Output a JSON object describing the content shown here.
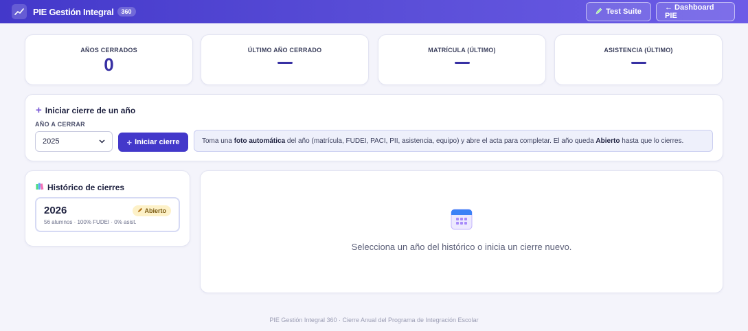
{
  "header": {
    "title": "PIE Gestión Integral",
    "badge": "360",
    "test_suite_label": "Test Suite",
    "dashboard_label": "← Dashboard PIE"
  },
  "stats": [
    {
      "label": "AÑOS CERRADOS",
      "value": "0"
    },
    {
      "label": "ÚLTIMO AÑO CERRADO",
      "value": "—"
    },
    {
      "label": "MATRÍCULA (ÚLTIMO)",
      "value": "—"
    },
    {
      "label": "ASISTENCIA (ÚLTIMO)",
      "value": "—"
    }
  ],
  "start_section": {
    "title": "Iniciar cierre de un año",
    "field_label": "AÑO A CERRAR",
    "selected_year": "2025",
    "button_label": "Iniciar cierre",
    "info": {
      "part1": "Toma una ",
      "bold1": "foto automática",
      "part2": " del año (matrícula, FUDEI, PACI, PII, asistencia, equipo) y abre el acta para completar. El año queda ",
      "bold2": "Abierto",
      "part3": " hasta que lo cierres."
    }
  },
  "history": {
    "title": "Histórico de cierres",
    "items": [
      {
        "year": "2026",
        "status": "Abierto",
        "meta": "56 alumnos · 100% FUDEI · 0% asist."
      }
    ]
  },
  "detail": {
    "empty_message": "Selecciona un año del histórico o inicia un cierre nuevo."
  },
  "footer": "PIE Gestión Integral 360 · Cierre Anual del Programa de Integración Escolar",
  "colors": {
    "header_gradient_start": "#4338ca",
    "header_gradient_end": "#6c5ce7",
    "accent": "#4338ca",
    "badge_open_bg": "#fdf1c8"
  },
  "icons": {
    "brand": "trend-chart-icon",
    "test_suite": "pencil-icon",
    "start_section": "plus-icon",
    "history": "books-icon",
    "open_badge": "pencil-icon",
    "detail_empty": "calendar-icon",
    "start_button": "plus-icon"
  }
}
